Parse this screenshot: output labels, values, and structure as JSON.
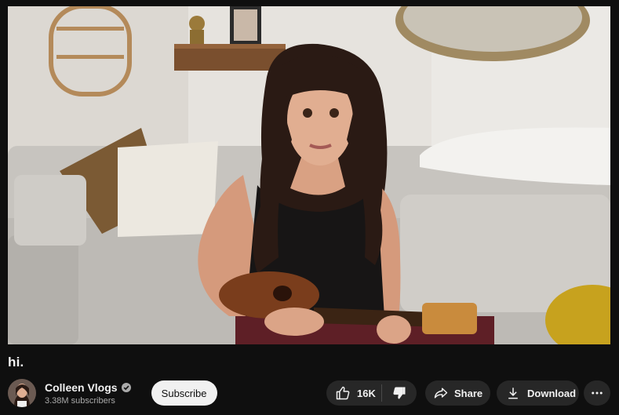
{
  "video": {
    "title": "hi."
  },
  "channel": {
    "name": "Colleen Vlogs",
    "subscribers": "3.38M subscribers",
    "verified": true
  },
  "actions": {
    "subscribe_label": "Subscribe",
    "like_count": "16K",
    "share_label": "Share",
    "download_label": "Download"
  },
  "icons": {
    "like": "thumbs-up-icon",
    "dislike": "thumbs-down-icon",
    "share": "share-arrow-icon",
    "download": "download-icon",
    "more": "more-horizontal-icon",
    "verified": "verified-check-icon"
  },
  "colors": {
    "background": "#0f0f0f",
    "pill": "#272727",
    "subscribe_bg": "#f1f1f1",
    "text_primary": "#f1f1f1",
    "text_secondary": "#aaaaaa"
  }
}
